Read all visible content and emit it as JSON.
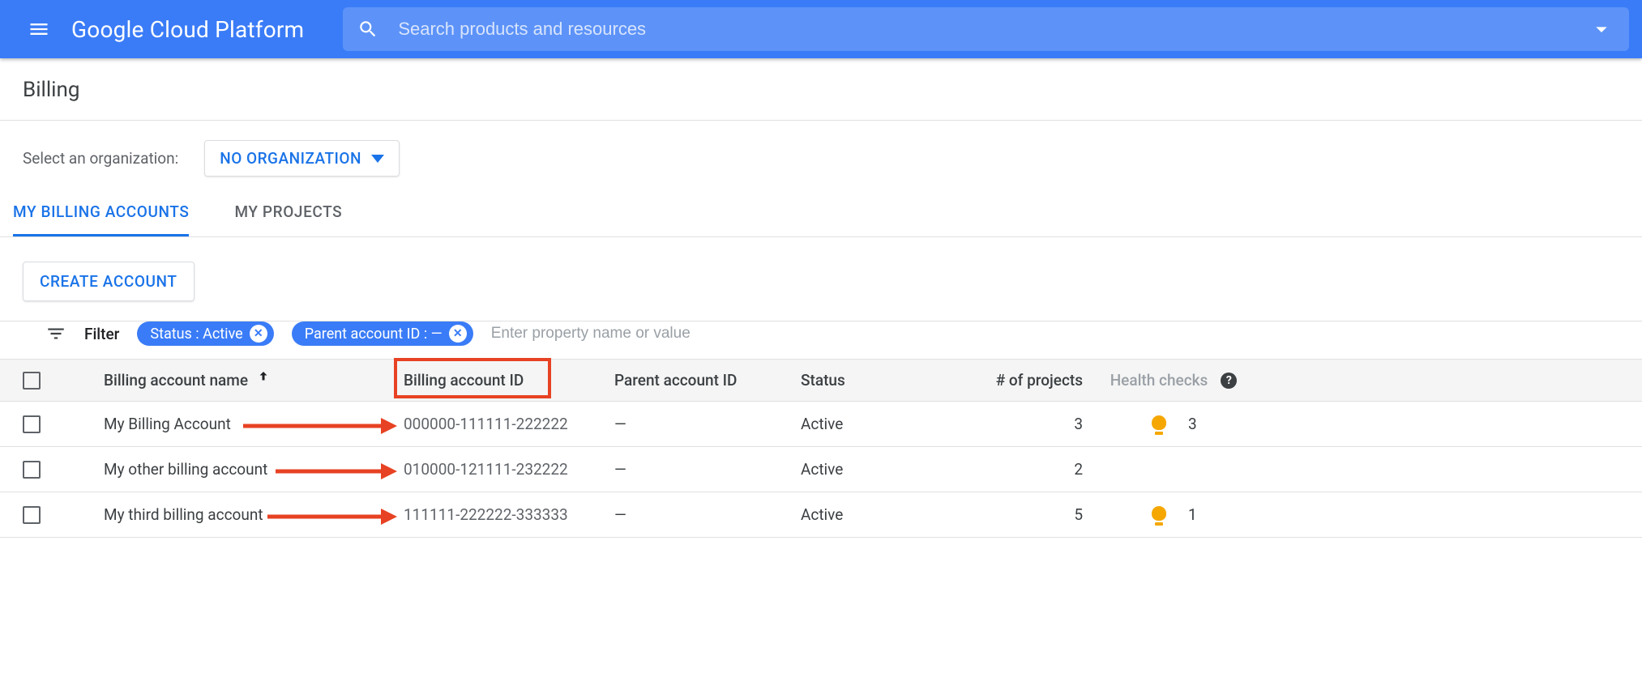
{
  "header": {
    "brand": "Google Cloud Platform",
    "search_placeholder": "Search products and resources"
  },
  "page": {
    "title": "Billing",
    "org_label": "Select an organization:",
    "org_value": "NO ORGANIZATION"
  },
  "tabs": {
    "billing": "MY BILLING ACCOUNTS",
    "projects": "MY PROJECTS"
  },
  "actions": {
    "create_account": "CREATE ACCOUNT"
  },
  "filter": {
    "label": "Filter",
    "chip_status": "Status : Active",
    "chip_parent": "Parent account ID : —",
    "input_placeholder": "Enter property name or value"
  },
  "columns": {
    "name": "Billing account name",
    "id": "Billing account ID",
    "parent": "Parent account ID",
    "status": "Status",
    "projects": "# of projects",
    "health": "Health checks"
  },
  "rows": [
    {
      "name": "My Billing Account",
      "id": "000000-111111-222222",
      "parent": "—",
      "status": "Active",
      "projects": "3",
      "health": "3"
    },
    {
      "name": "My other billing account",
      "id": "010000-121111-232222",
      "parent": "—",
      "status": "Active",
      "projects": "2",
      "health": ""
    },
    {
      "name": "My third billing account",
      "id": "111111-222222-333333",
      "parent": "—",
      "status": "Active",
      "projects": "5",
      "health": "1"
    }
  ]
}
